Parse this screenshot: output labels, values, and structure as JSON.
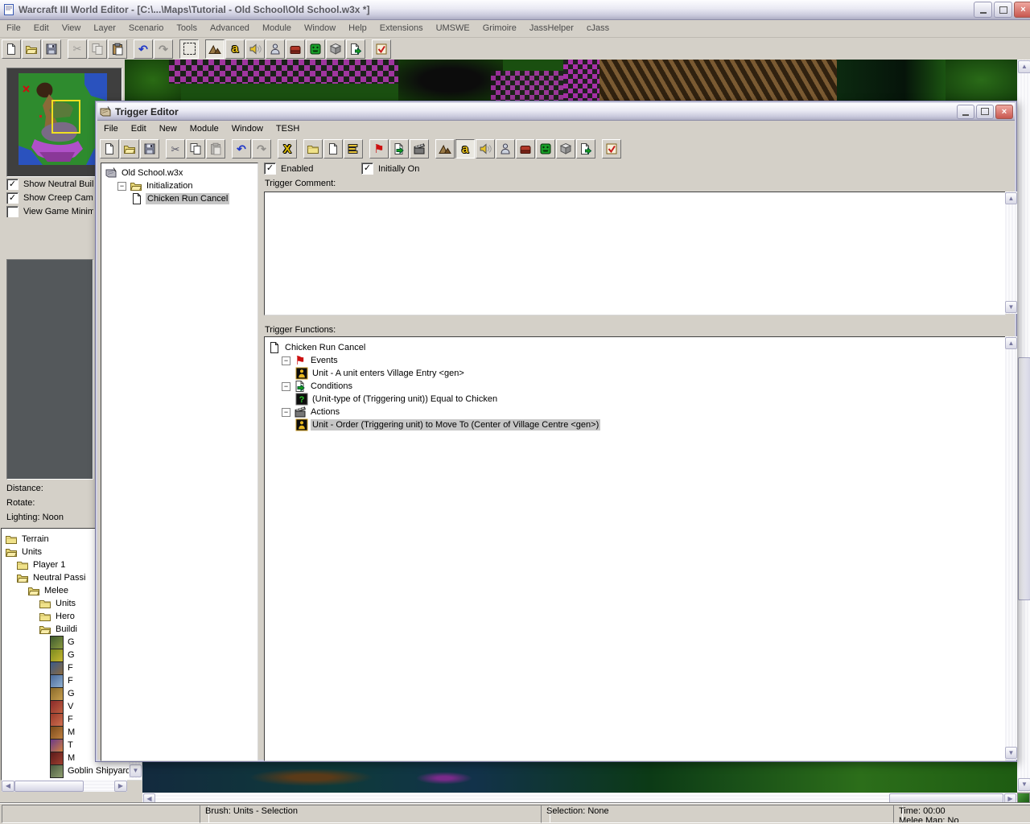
{
  "window": {
    "title": "Warcraft III World Editor - [C:\\...\\Maps\\Tutorial - Old School\\Old School.w3x *]"
  },
  "main_menu": [
    "File",
    "Edit",
    "View",
    "Layer",
    "Scenario",
    "Tools",
    "Advanced",
    "Module",
    "Window",
    "Help",
    "Extensions",
    "UMSWE",
    "Grimoire",
    "JassHelper",
    "cJass"
  ],
  "main_toolbar": [
    {
      "name": "new-document",
      "icon": "page-new"
    },
    {
      "name": "open-map",
      "icon": "folder-open"
    },
    {
      "name": "save-map",
      "icon": "floppy"
    },
    "sep",
    {
      "name": "cut",
      "icon": "scissors",
      "state": "disabled"
    },
    {
      "name": "copy",
      "icon": "copy",
      "state": "disabled"
    },
    {
      "name": "paste",
      "icon": "paste"
    },
    "sep",
    {
      "name": "undo",
      "icon": "undo"
    },
    {
      "name": "redo",
      "icon": "redo",
      "state": "disabled"
    },
    "sep",
    {
      "name": "selection-tool",
      "icon": "select",
      "state": "pressed"
    },
    "sep",
    {
      "name": "terrain-editor",
      "icon": "mountain",
      "state": "pressed"
    },
    {
      "name": "trigger-editor",
      "icon": "letter-a"
    },
    {
      "name": "sound-editor",
      "icon": "speaker"
    },
    {
      "name": "object-editor",
      "icon": "unit"
    },
    {
      "name": "campaign-editor",
      "icon": "item"
    },
    {
      "name": "ai-editor",
      "icon": "face"
    },
    {
      "name": "object-manager",
      "icon": "cube"
    },
    {
      "name": "import-manager",
      "icon": "import"
    },
    "sep",
    {
      "name": "test-map",
      "icon": "test"
    }
  ],
  "minimap_panel": {
    "checkboxes": [
      {
        "label": "Show Neutral Build",
        "checked": true
      },
      {
        "label": "Show Creep Camp",
        "checked": true
      },
      {
        "label": "View Game Minima",
        "checked": false
      }
    ]
  },
  "camera_panel": {
    "distance_label": "Distance:",
    "rotate_label": "Rotate:",
    "lighting_label": "Lighting: Noon"
  },
  "palette_tree": [
    {
      "depth": 0,
      "icon": "folder",
      "label": "Terrain"
    },
    {
      "depth": 0,
      "icon": "folder-open",
      "label": "Units"
    },
    {
      "depth": 1,
      "icon": "folder",
      "label": "Player 1"
    },
    {
      "depth": 1,
      "icon": "folder-open",
      "label": "Neutral Passi"
    },
    {
      "depth": 2,
      "icon": "folder-open",
      "label": "Melee"
    },
    {
      "depth": 3,
      "icon": "folder",
      "label": "Units"
    },
    {
      "depth": 3,
      "icon": "folder",
      "label": "Hero"
    },
    {
      "depth": 3,
      "icon": "folder-open",
      "label": "Buildi"
    },
    {
      "depth": 4,
      "icon": "unit-portrait",
      "c1": "#3e5a2e",
      "c2": "#8a9a40",
      "label": "G"
    },
    {
      "depth": 4,
      "icon": "unit-portrait",
      "c1": "#7a8a20",
      "c2": "#c8b830",
      "label": "G"
    },
    {
      "depth": 4,
      "icon": "unit-portrait",
      "c1": "#3a5a8a",
      "c2": "#8a6a40",
      "label": "F"
    },
    {
      "depth": 4,
      "icon": "unit-portrait",
      "c1": "#4a6a9a",
      "c2": "#90b0d0",
      "label": "F"
    },
    {
      "depth": 4,
      "icon": "unit-portrait",
      "c1": "#8a6a2a",
      "c2": "#c8a050",
      "label": "G"
    },
    {
      "depth": 4,
      "icon": "unit-portrait",
      "c1": "#8a2a2a",
      "c2": "#c06040",
      "label": "V"
    },
    {
      "depth": 4,
      "icon": "unit-portrait",
      "c1": "#9a3a2a",
      "c2": "#d07050",
      "label": "F"
    },
    {
      "depth": 4,
      "icon": "unit-portrait",
      "c1": "#7a4a1a",
      "c2": "#c08040",
      "label": "M"
    },
    {
      "depth": 4,
      "icon": "unit-portrait",
      "c1": "#6a3a8a",
      "c2": "#d08040",
      "label": "T"
    },
    {
      "depth": 4,
      "icon": "unit-portrait",
      "c1": "#5a1a1a",
      "c2": "#a04030",
      "label": "M"
    },
    {
      "depth": 4,
      "icon": "unit-portrait",
      "c1": "#4a5a40",
      "c2": "#90a070",
      "label": "Goblin Shipyard"
    }
  ],
  "trigger_editor": {
    "title": "Trigger Editor",
    "menu": [
      "File",
      "Edit",
      "New",
      "Module",
      "Window",
      "TESH"
    ],
    "toolbar": [
      {
        "name": "new-document",
        "icon": "page-new"
      },
      {
        "name": "open",
        "icon": "folder-open"
      },
      {
        "name": "save",
        "icon": "floppy"
      },
      "sep",
      {
        "name": "cut",
        "icon": "scissors"
      },
      {
        "name": "copy",
        "icon": "copy"
      },
      {
        "name": "paste",
        "icon": "paste",
        "state": "disabled"
      },
      "sep",
      {
        "name": "undo",
        "icon": "undo"
      },
      {
        "name": "redo",
        "icon": "redo",
        "state": "disabled"
      },
      "sep",
      {
        "name": "delete-trigger",
        "icon": "x-delete"
      },
      "sep",
      {
        "name": "new-category",
        "icon": "folder"
      },
      {
        "name": "new-trigger",
        "icon": "page-new"
      },
      {
        "name": "new-comment",
        "icon": "comment"
      },
      "sep",
      {
        "name": "new-event",
        "icon": "flag"
      },
      {
        "name": "new-condition",
        "icon": "condition"
      },
      {
        "name": "new-action",
        "icon": "clapper"
      },
      "sep",
      {
        "name": "terrain-editor",
        "icon": "mountain"
      },
      {
        "name": "trigger-editor",
        "icon": "letter-a",
        "state": "pressed"
      },
      {
        "name": "sound-editor",
        "icon": "speaker"
      },
      {
        "name": "object-editor",
        "icon": "unit"
      },
      {
        "name": "campaign-editor",
        "icon": "item"
      },
      {
        "name": "ai-editor",
        "icon": "face"
      },
      {
        "name": "object-manager",
        "icon": "cube"
      },
      {
        "name": "import-manager",
        "icon": "import"
      },
      "sep",
      {
        "name": "test-map",
        "icon": "test"
      }
    ],
    "trigger_tree": [
      {
        "indent": 0,
        "icon": "map-scroll",
        "label": "Old School.w3x"
      },
      {
        "indent": 1,
        "expander": true,
        "icon": "folder-open",
        "label": "Initialization"
      },
      {
        "indent": 2,
        "icon": "page",
        "label": "Chicken Run Cancel",
        "selected": true
      }
    ],
    "enabled_label": "Enabled",
    "enabled_checked": true,
    "initially_on_label": "Initially On",
    "initially_on_checked": true,
    "comment_label": "Trigger Comment:",
    "comment_value": "",
    "functions_label": "Trigger Functions:",
    "functions_tree": [
      {
        "indent": 0,
        "icon": "page",
        "label": "Chicken Run Cancel"
      },
      {
        "indent": 1,
        "expander": true,
        "icon": "flag",
        "label": "Events"
      },
      {
        "indent": 2,
        "icon": "unit-event",
        "label": "Unit - A unit enters Village Entry <gen>"
      },
      {
        "indent": 1,
        "expander": true,
        "icon": "condition",
        "label": "Conditions"
      },
      {
        "indent": 2,
        "icon": "question",
        "label": "(Unit-type of (Triggering unit)) Equal to Chicken"
      },
      {
        "indent": 1,
        "expander": true,
        "icon": "clapper",
        "label": "Actions"
      },
      {
        "indent": 2,
        "icon": "unit-event",
        "label": "Unit - Order (Triggering unit) to Move To (Center of Village Centre <gen>)",
        "selected": true
      }
    ]
  },
  "status_bar": {
    "sections": [
      {
        "name": "status-empty",
        "lines": [
          ""
        ]
      },
      {
        "name": "status-brush",
        "lines": [
          "Brush: Units - Selection"
        ]
      },
      {
        "name": "status-selection",
        "lines": [
          "Selection: None"
        ]
      },
      {
        "name": "status-time",
        "lines": [
          "Time: 00:00",
          "Melee Map: No"
        ]
      }
    ]
  }
}
